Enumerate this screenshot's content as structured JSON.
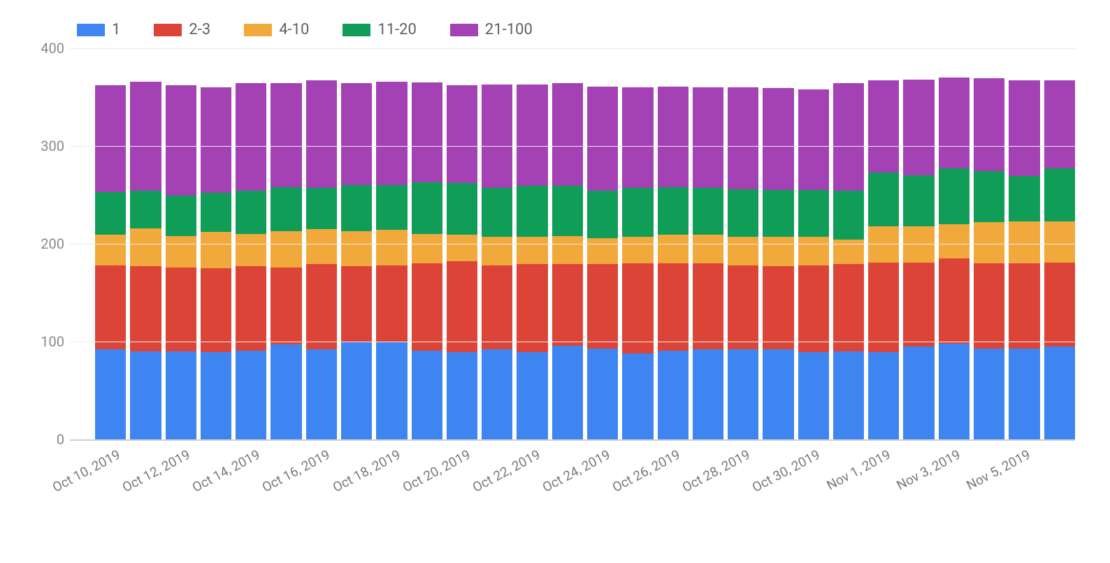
{
  "legend": [
    {
      "key": "s1",
      "label": "1",
      "color": "#3f85f2"
    },
    {
      "key": "s2",
      "label": "2-3",
      "color": "#db4437"
    },
    {
      "key": "s3",
      "label": "4-10",
      "color": "#f2a93b"
    },
    {
      "key": "s4",
      "label": "11-20",
      "color": "#109d58"
    },
    {
      "key": "s5",
      "label": "21-100",
      "color": "#a341b5"
    }
  ],
  "y_ticks": [
    0,
    100,
    200,
    300,
    400
  ],
  "y_max": 400,
  "x_labels_every_other": [
    "Oct 10, 2019",
    "Oct 12, 2019",
    "Oct 14, 2019",
    "Oct 16, 2019",
    "Oct 18, 2019",
    "Oct 20, 2019",
    "Oct 22, 2019",
    "Oct 24, 2019",
    "Oct 26, 2019",
    "Oct 28, 2019",
    "Oct 30, 2019",
    "Nov 1, 2019",
    "Nov 3, 2019",
    "Nov 5, 2019"
  ],
  "chart_data": {
    "type": "bar",
    "stacked": true,
    "ylim": [
      0,
      400
    ],
    "xlabel": "",
    "ylabel": "",
    "categories": [
      "Oct 10, 2019",
      "Oct 11, 2019",
      "Oct 12, 2019",
      "Oct 13, 2019",
      "Oct 14, 2019",
      "Oct 15, 2019",
      "Oct 16, 2019",
      "Oct 17, 2019",
      "Oct 18, 2019",
      "Oct 19, 2019",
      "Oct 20, 2019",
      "Oct 21, 2019",
      "Oct 22, 2019",
      "Oct 23, 2019",
      "Oct 24, 2019",
      "Oct 25, 2019",
      "Oct 26, 2019",
      "Oct 27, 2019",
      "Oct 28, 2019",
      "Oct 29, 2019",
      "Oct 30, 2019",
      "Oct 31, 2019",
      "Nov 1, 2019",
      "Nov 2, 2019",
      "Nov 3, 2019",
      "Nov 4, 2019",
      "Nov 5, 2019",
      "Nov 6, 2019"
    ],
    "series": [
      {
        "name": "1",
        "values": [
          92,
          90,
          90,
          89,
          91,
          97,
          92,
          99,
          100,
          91,
          89,
          92,
          89,
          96,
          93,
          88,
          91,
          92,
          92,
          92,
          89,
          90,
          89,
          95,
          98,
          93,
          93,
          95
        ]
      },
      {
        "name": "2-3",
        "values": [
          86,
          87,
          86,
          86,
          86,
          79,
          87,
          78,
          78,
          89,
          93,
          86,
          90,
          83,
          86,
          92,
          89,
          88,
          86,
          85,
          89,
          89,
          92,
          86,
          87,
          87,
          87,
          86
        ]
      },
      {
        "name": "4-10",
        "values": [
          31,
          39,
          32,
          37,
          33,
          37,
          36,
          36,
          36,
          30,
          27,
          29,
          28,
          29,
          27,
          27,
          29,
          29,
          29,
          30,
          29,
          25,
          37,
          37,
          35,
          42,
          43,
          42
        ]
      },
      {
        "name": "11-20",
        "values": [
          44,
          38,
          41,
          40,
          44,
          45,
          42,
          47,
          46,
          53,
          53,
          50,
          52,
          51,
          48,
          50,
          49,
          48,
          49,
          48,
          48,
          50,
          55,
          52,
          57,
          52,
          46,
          54
        ]
      },
      {
        "name": "21-100",
        "values": [
          109,
          112,
          113,
          108,
          110,
          106,
          110,
          104,
          106,
          102,
          100,
          106,
          104,
          105,
          107,
          103,
          103,
          103,
          104,
          104,
          103,
          110,
          94,
          98,
          93,
          95,
          98,
          90
        ]
      }
    ]
  }
}
